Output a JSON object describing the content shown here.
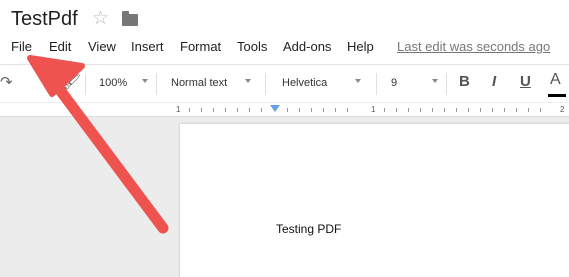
{
  "header": {
    "doc_title": "TestPdf",
    "star_icon": "star-icon",
    "folder_icon": "folder-icon"
  },
  "menu": {
    "items": [
      "File",
      "Edit",
      "View",
      "Insert",
      "Format",
      "Tools",
      "Add-ons",
      "Help"
    ],
    "last_edit": "Last edit was seconds ago"
  },
  "toolbar": {
    "redo_icon": "redo-icon",
    "paint_format_icon": "paint-format-icon",
    "zoom": "100%",
    "style": "Normal text",
    "font": "Helvetica",
    "font_size": "9",
    "bold": "B",
    "italic": "I",
    "underline": "U",
    "text_color": "A"
  },
  "ruler": {
    "numbers": [
      "1",
      "1",
      "2"
    ]
  },
  "document": {
    "body_text": "Testing PDF"
  },
  "annotation": {
    "arrow_color": "#ef5350"
  }
}
